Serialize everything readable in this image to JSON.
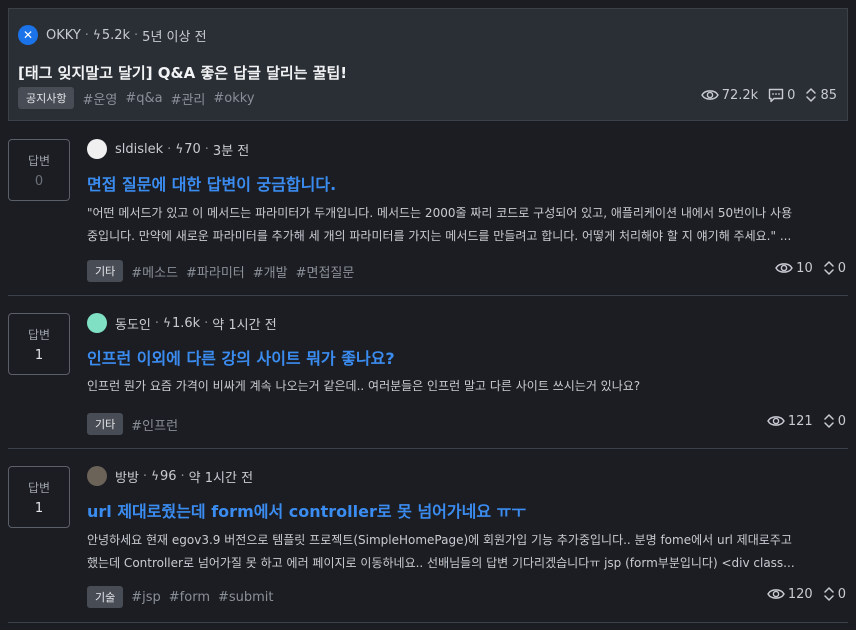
{
  "notice": {
    "author": "OKKY",
    "score": "5.2k",
    "time": "5년 이상 전",
    "title": "[태그 잊지말고 달기] Q&A 좋은 답글 달리는 꿀팁!",
    "badge": "공지사항",
    "tags": [
      "#운영",
      "#q&a",
      "#관리",
      "#okky"
    ],
    "views": "72.2k",
    "comments": "0",
    "votes": "85"
  },
  "answer_label": "답변",
  "posts": [
    {
      "author": "sldislek",
      "score": "70",
      "time": "3분 전",
      "answers": "0",
      "title": "면접 질문에 대한 답변이 궁금합니다.",
      "excerpt_lines": [
        "\"어떤 메서드가 있고 이 메서드는 파라미터가 두개입니다. 메서드는 2000줄 짜리 코드로 구성되어 있고, 애플리케이션 내에서 50번이나 사용",
        "중입니다. 만약에 새로운 파라미터를 추가해 세 개의 파라미터를 가지는 메서드를 만들려고 합니다. 어떻게 처리해야 할 지 얘기해 주세요.\" ..."
      ],
      "badge": "기타",
      "tags": [
        "#메소드",
        "#파라미터",
        "#개발",
        "#면접질문"
      ],
      "views": "10",
      "votes": "0"
    },
    {
      "author": "동도인",
      "score": "1.6k",
      "time": "약 1시간 전",
      "answers": "1",
      "title": "인프런 이외에 다른 강의 사이트 뭐가 좋나요?",
      "excerpt_lines": [
        "인프런 뭔가 요즘 가격이 비싸게 계속 나오는거 같은데.. 여러분들은 인프런 말고 다른 사이트 쓰시는거 있나요?"
      ],
      "badge": "기타",
      "tags": [
        "#인프런"
      ],
      "views": "121",
      "votes": "0"
    },
    {
      "author": "방방",
      "score": "96",
      "time": "약 1시간 전",
      "answers": "1",
      "title": "url 제대로줬는데 form에서 controller로 못 넘어가네요 ㅠㅜ",
      "excerpt_lines": [
        "안녕하세요 현재 egov3.9 버전으로 템플릿 프로젝트(SimpleHomePage)에 회원가입 기능 추가중입니다.. 분명 fome에서 url 제대로주고",
        "했는데 Controller로 넘어가질 못 하고 에러 페이지로 이동하네요.. 선배님들의 답변 기다리겠습니다ㅠ jsp (form부분입니다) <div class..."
      ],
      "badge": "기술",
      "tags": [
        "#jsp",
        "#form",
        "#submit"
      ],
      "views": "120",
      "votes": "0"
    }
  ],
  "colors": {
    "accent_link": "#3b8cf0",
    "notice_bg": "#2a2e35",
    "page_bg": "#1b1d22"
  }
}
